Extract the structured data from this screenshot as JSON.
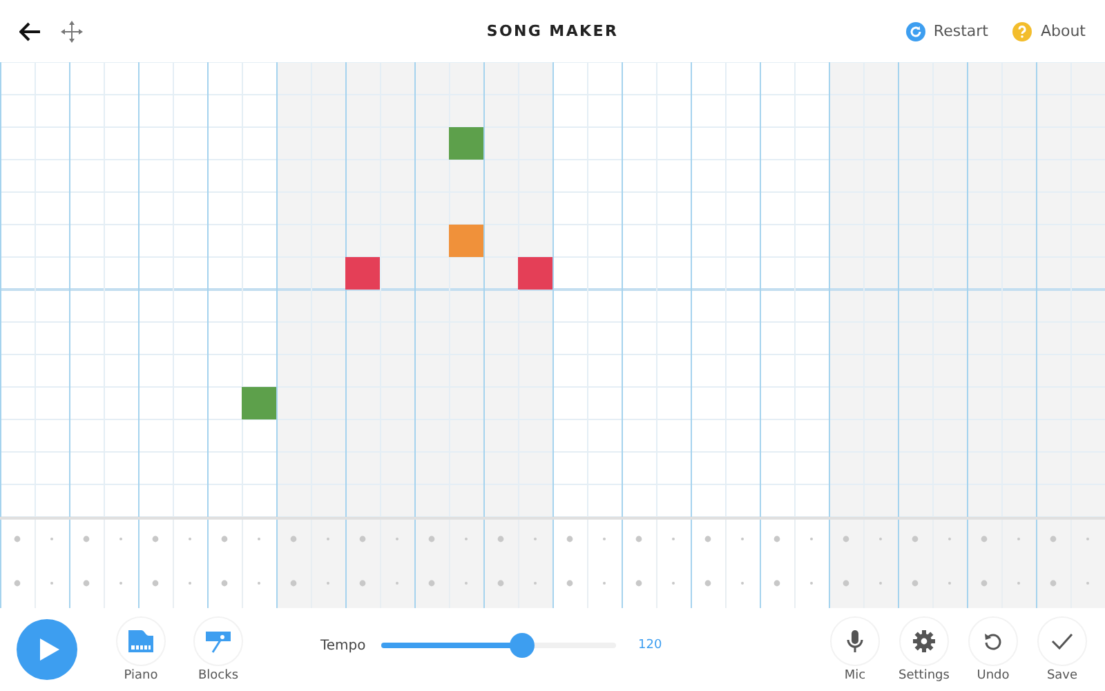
{
  "header": {
    "title": "SONG MAKER",
    "restart": "Restart",
    "about": "About"
  },
  "melody": {
    "rows": [
      {
        "cells": [
          null,
          null,
          null,
          null,
          null,
          null,
          null,
          null,
          null,
          null,
          null,
          null,
          null,
          null,
          null,
          null,
          null,
          null,
          null,
          null,
          null,
          null,
          null,
          null,
          null,
          null,
          null,
          null,
          null,
          null,
          null,
          null
        ]
      },
      {
        "cells": [
          null,
          null,
          null,
          null,
          null,
          null,
          null,
          null,
          null,
          null,
          null,
          null,
          null,
          null,
          null,
          null,
          null,
          null,
          null,
          null,
          null,
          null,
          null,
          null,
          null,
          null,
          null,
          null,
          null,
          null,
          null,
          null
        ]
      },
      {
        "cells": [
          null,
          null,
          null,
          null,
          null,
          null,
          null,
          null,
          null,
          null,
          null,
          null,
          null,
          {
            "color": "#5da04b"
          },
          null,
          null,
          null,
          null,
          null,
          null,
          null,
          null,
          null,
          null,
          null,
          null,
          null,
          null,
          null,
          null,
          null,
          null
        ]
      },
      {
        "cells": [
          null,
          null,
          null,
          null,
          null,
          null,
          null,
          null,
          null,
          null,
          null,
          null,
          null,
          null,
          null,
          null,
          null,
          null,
          null,
          null,
          null,
          null,
          null,
          null,
          null,
          null,
          null,
          null,
          null,
          null,
          null,
          null
        ]
      },
      {
        "cells": [
          null,
          null,
          null,
          null,
          null,
          null,
          null,
          null,
          null,
          null,
          null,
          null,
          null,
          null,
          null,
          null,
          null,
          null,
          null,
          null,
          null,
          null,
          null,
          null,
          null,
          null,
          null,
          null,
          null,
          null,
          null,
          null
        ]
      },
      {
        "cells": [
          null,
          null,
          null,
          null,
          null,
          null,
          null,
          null,
          null,
          null,
          null,
          null,
          null,
          {
            "color": "#f0913a"
          },
          null,
          null,
          null,
          null,
          null,
          null,
          null,
          null,
          null,
          null,
          null,
          null,
          null,
          null,
          null,
          null,
          null,
          null
        ]
      },
      {
        "cells": [
          null,
          null,
          null,
          null,
          null,
          null,
          null,
          null,
          null,
          null,
          {
            "color": "#e43f57"
          },
          null,
          null,
          null,
          null,
          {
            "color": "#e43f57"
          },
          null,
          null,
          null,
          null,
          null,
          null,
          null,
          null,
          null,
          null,
          null,
          null,
          null,
          null,
          null,
          null
        ]
      },
      {
        "cells": [
          null,
          null,
          null,
          null,
          null,
          null,
          null,
          null,
          null,
          null,
          null,
          null,
          null,
          null,
          null,
          null,
          null,
          null,
          null,
          null,
          null,
          null,
          null,
          null,
          null,
          null,
          null,
          null,
          null,
          null,
          null,
          null
        ]
      },
      {
        "cells": [
          null,
          null,
          null,
          null,
          null,
          null,
          null,
          null,
          null,
          null,
          null,
          null,
          null,
          null,
          null,
          null,
          null,
          null,
          null,
          null,
          null,
          null,
          null,
          null,
          null,
          null,
          null,
          null,
          null,
          null,
          null,
          null
        ]
      },
      {
        "cells": [
          null,
          null,
          null,
          null,
          null,
          null,
          null,
          null,
          null,
          null,
          null,
          null,
          null,
          null,
          null,
          null,
          null,
          null,
          null,
          null,
          null,
          null,
          null,
          null,
          null,
          null,
          null,
          null,
          null,
          null,
          null,
          null
        ]
      },
      {
        "cells": [
          null,
          null,
          null,
          null,
          null,
          null,
          null,
          {
            "color": "#5da04b"
          },
          null,
          null,
          null,
          null,
          null,
          null,
          null,
          null,
          null,
          null,
          null,
          null,
          null,
          null,
          null,
          null,
          null,
          null,
          null,
          null,
          null,
          null,
          null,
          null
        ]
      },
      {
        "cells": [
          null,
          null,
          null,
          null,
          null,
          null,
          null,
          null,
          null,
          null,
          null,
          null,
          null,
          null,
          null,
          null,
          null,
          null,
          null,
          null,
          null,
          null,
          null,
          null,
          null,
          null,
          null,
          null,
          null,
          null,
          null,
          null
        ]
      },
      {
        "cells": [
          null,
          null,
          null,
          null,
          null,
          null,
          null,
          null,
          null,
          null,
          null,
          null,
          null,
          null,
          null,
          null,
          null,
          null,
          null,
          null,
          null,
          null,
          null,
          null,
          null,
          null,
          null,
          null,
          null,
          null,
          null,
          null
        ]
      },
      {
        "cells": [
          null,
          null,
          null,
          null,
          null,
          null,
          null,
          null,
          null,
          null,
          null,
          null,
          null,
          null,
          null,
          null,
          null,
          null,
          null,
          null,
          null,
          null,
          null,
          null,
          null,
          null,
          null,
          null,
          null,
          null,
          null,
          null
        ]
      }
    ]
  },
  "instruments": [
    {
      "kind": "piano",
      "label": "Piano"
    },
    {
      "kind": "blocks",
      "label": "Blocks"
    }
  ],
  "tempo": {
    "label": "Tempo",
    "level": 0.6,
    "reading": "120"
  },
  "actions": [
    {
      "kind": "mic",
      "label": "Mic"
    },
    {
      "kind": "settings",
      "label": "Settings"
    },
    {
      "kind": "undo",
      "label": "Undo"
    },
    {
      "kind": "save",
      "label": "Save"
    }
  ]
}
